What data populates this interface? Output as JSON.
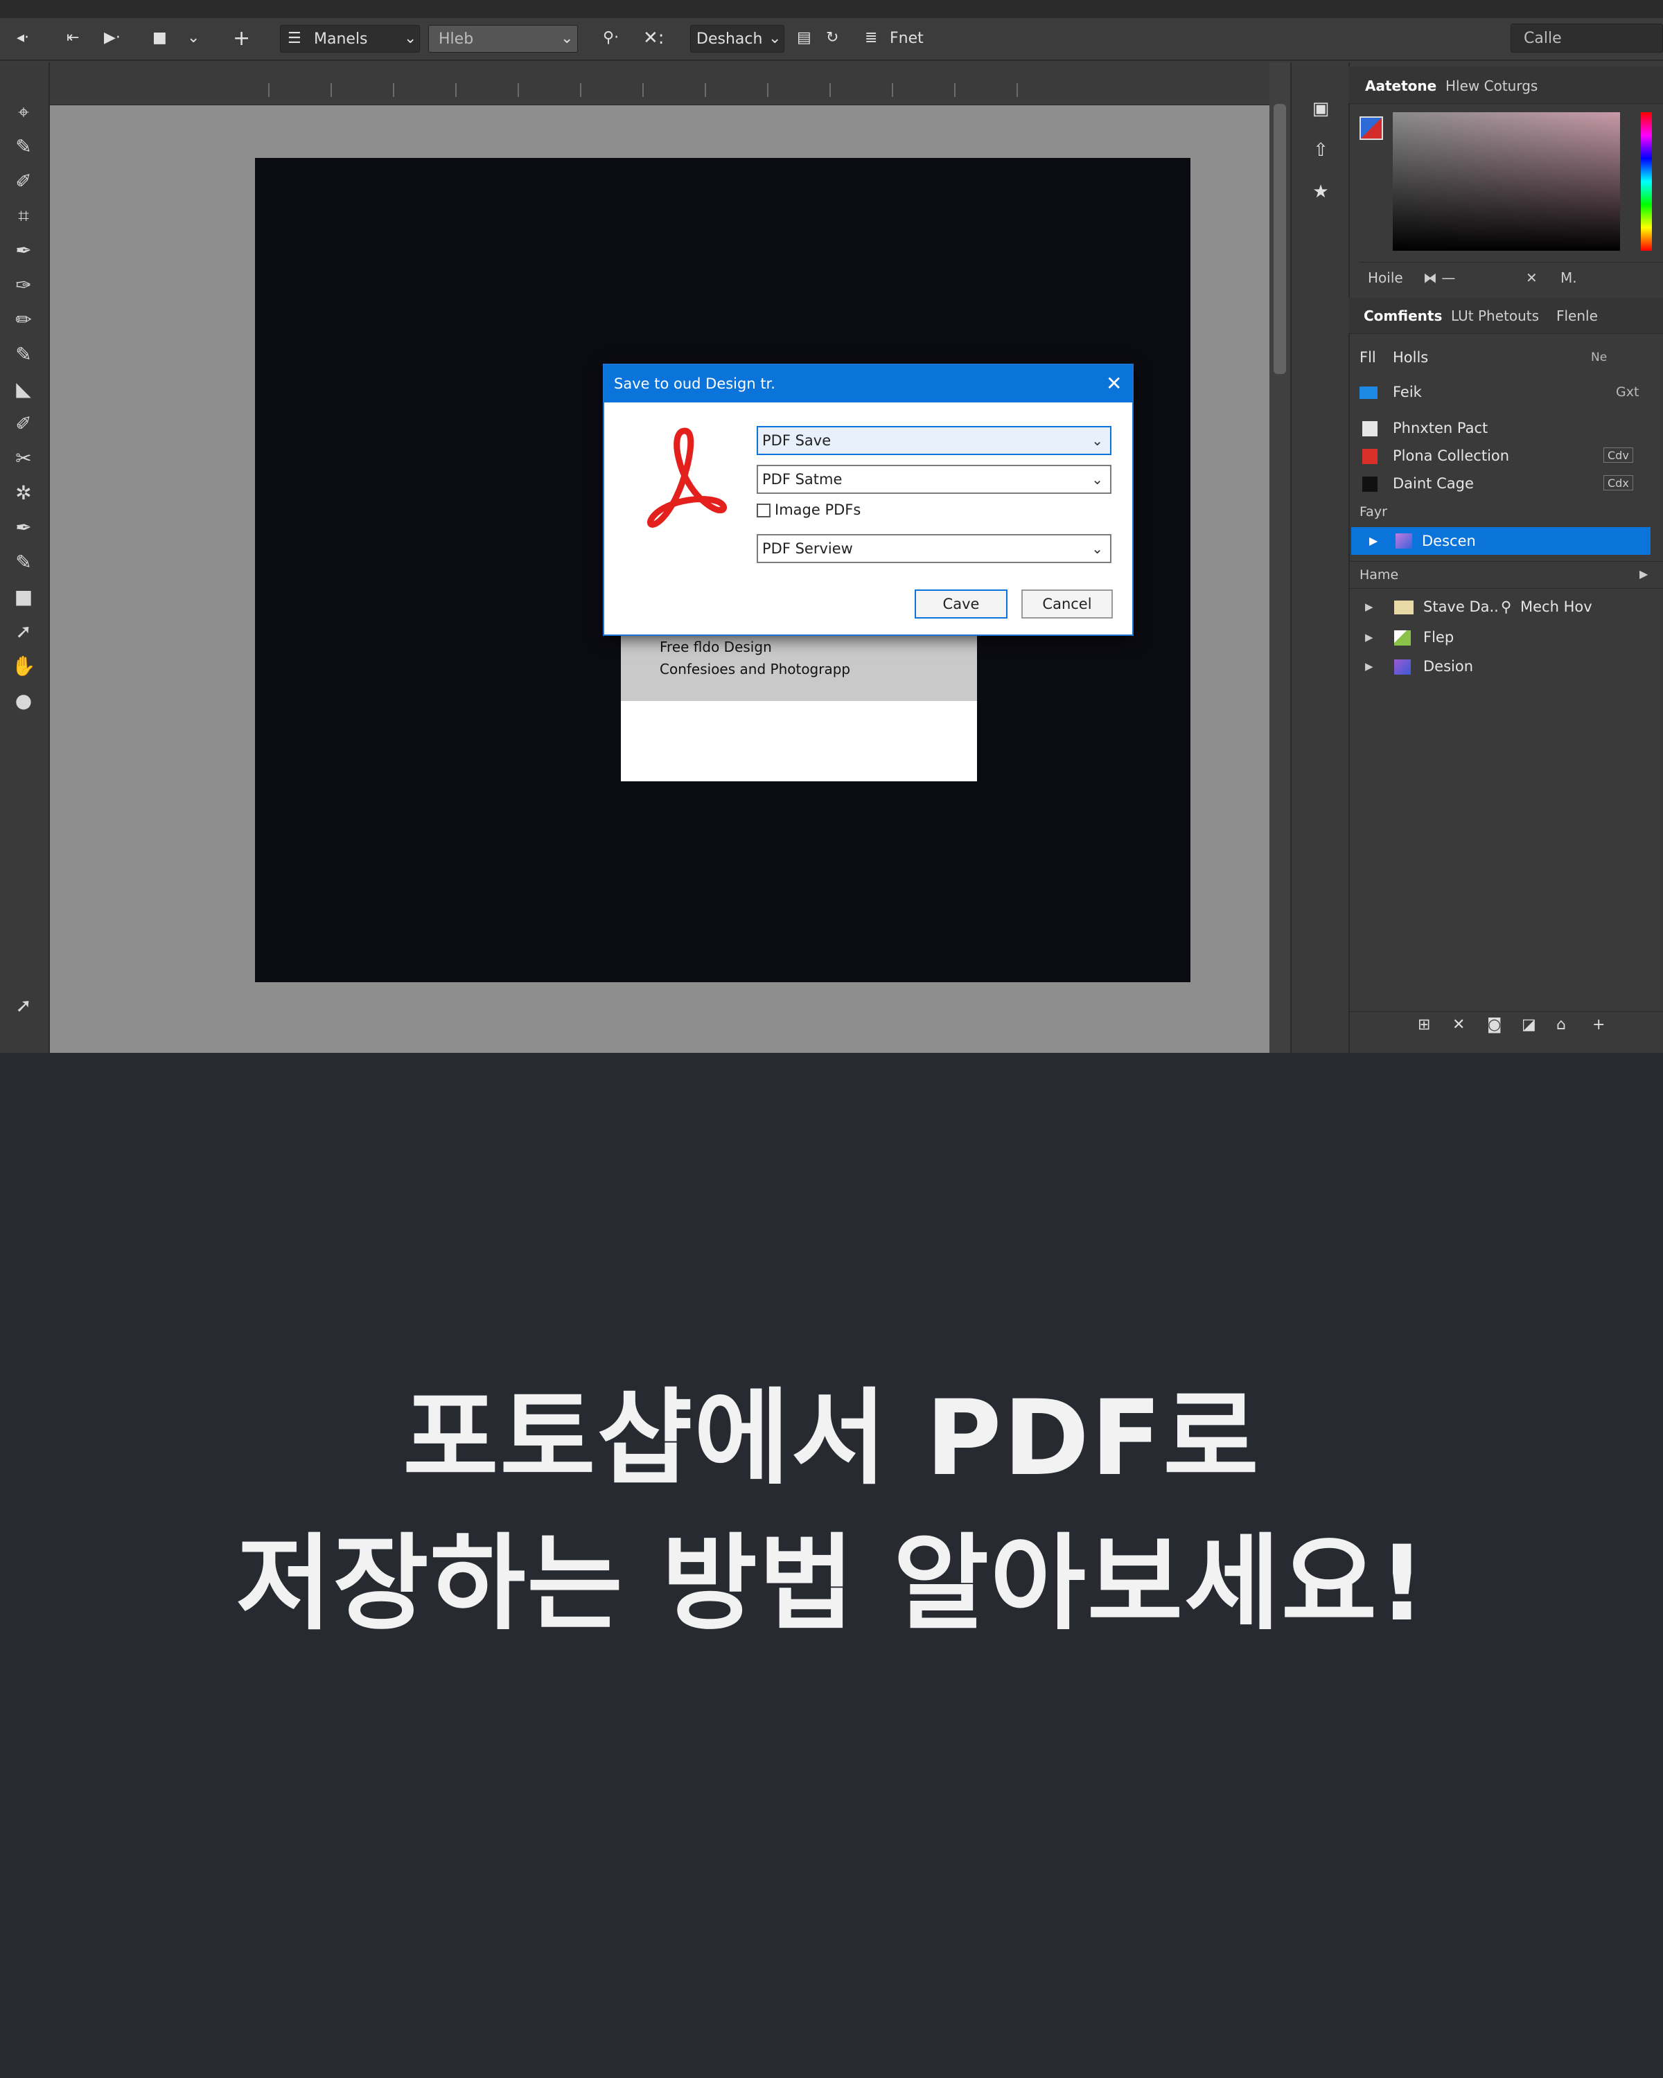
{
  "optionsbar": {
    "group1": "Manels",
    "group2": "Hleb",
    "group3": "Deshach",
    "group4": "Fnet",
    "search": "Calle"
  },
  "panel": {
    "tab1": "Aatetone",
    "tab2": "Hlew Coturgs",
    "color_row": [
      "Hoile",
      "M."
    ],
    "tabs2": [
      "Comfients",
      "LUt Phetouts",
      "Flenle"
    ],
    "rows": [
      {
        "label": "Fll",
        "text": "Holls",
        "right": "Ne"
      },
      {
        "label": "",
        "text": "Feik",
        "right": "Gxt"
      },
      {
        "label": "",
        "text": "Phnxten Pact",
        "right": ""
      },
      {
        "label": "",
        "text": "Plona Collection",
        "right": "Cdv"
      },
      {
        "label": "",
        "text": "Daint Cage",
        "right": "Cdx"
      }
    ],
    "section1": "Fayr",
    "selected_item": "Descen",
    "section2": "Hame",
    "tree": [
      {
        "text": "Stave Da..",
        "extra": "Mech Hov"
      },
      {
        "text": "Flep",
        "extra": ""
      },
      {
        "text": "Desion",
        "extra": ""
      }
    ]
  },
  "dialog": {
    "title": "Save to oud Design tr.",
    "select1": "PDF Save",
    "select2": "PDF Satme",
    "checkbox_label": "Image PDFs",
    "checkbox_checked": false,
    "select3": "PDF  Serview",
    "ok_label": "Cave",
    "cancel_label": "Cancel"
  },
  "behind_card": {
    "line1": "Free fldo Design",
    "line2": "Confesioes and Photograpp"
  },
  "caption": {
    "line1": "포토샵에서 PDF로",
    "line2": "저장하는 방법 알아보세요!"
  },
  "icons": {
    "close": "close-icon",
    "acrobat": "acrobat-logo-icon"
  }
}
